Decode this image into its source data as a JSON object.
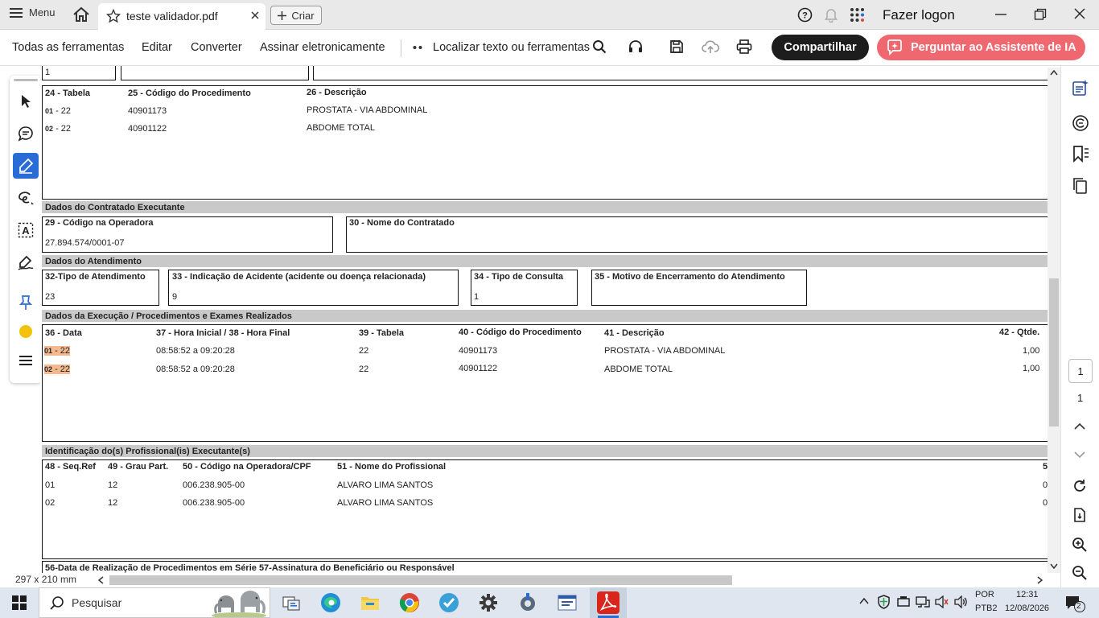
{
  "titlebar": {
    "menu_label": "Menu",
    "tab_title": "teste validador.pdf",
    "create_label": "Criar",
    "login_label": "Fazer logon"
  },
  "toolbar": {
    "all_tools": "Todas as ferramentas",
    "edit": "Editar",
    "convert": "Converter",
    "sign": "Assinar eletronicamente",
    "find": "Localizar texto ou ferramentas",
    "share": "Compartilhar",
    "ai": "Perguntar ao Assistente de IA"
  },
  "doc": {
    "top_row_value": "1",
    "proc_headers": {
      "tabela": "24 - Tabela",
      "codigo": "25 - Código do Procedimento",
      "descricao": "26 - Descrição"
    },
    "proc_rows": [
      {
        "idx": "01",
        "tabela": "22",
        "codigo": "40901173",
        "descricao": "PROSTATA - VIA  ABDOMINAL"
      },
      {
        "idx": "02",
        "tabela": "22",
        "codigo": "40901122",
        "descricao": "ABDOME TOTAL"
      }
    ],
    "sec_contratado": "Dados do Contratado Executante",
    "cod_operadora_label": "29 - Código na Operadora",
    "cod_operadora_value": "27.894.574/0001-07",
    "nome_contratado_label": "30 - Nome do Contratado",
    "sec_atendimento": "Dados do Atendimento",
    "tipo_atendimento_label": "32-Tipo de  Atendimento",
    "tipo_atendimento_value": "23",
    "acidente_label": "33 - Indicação de Acidente  (acidente ou doença relacionada)",
    "acidente_value": "9",
    "tipo_consulta_label": "34 - Tipo de Consulta",
    "tipo_consulta_value": "1",
    "motivo_label": "35 - Motivo de Encerramento do Atendimento",
    "sec_execucao": "Dados da Execução / Procedimentos e Exames Realizados",
    "exec_headers": {
      "data": "36 - Data",
      "hora": "37 - Hora Inicial / 38 - Hora Final",
      "tabela": "39 - Tabela",
      "codigo": "40 - Código do Procedimento",
      "descricao": "41 - Descrição",
      "qtde": "42 - Qtde."
    },
    "exec_rows": [
      {
        "idx": "01",
        "data": "22",
        "hora": "08:58:52 a 09:20:28",
        "tabela": "22",
        "codigo": "40901173",
        "descricao": "PROSTATA - VIA  ABDOMINAL",
        "qtde": "1,00"
      },
      {
        "idx": "02",
        "data": "22",
        "hora": "08:58:52 a 09:20:28",
        "tabela": "22",
        "codigo": "40901122",
        "descricao": "ABDOME TOTAL",
        "qtde": "1,00"
      }
    ],
    "sec_profissional": "Identificação do(s) Profissional(is) Executante(s)",
    "prof_headers": {
      "seq": "48 - Seq.Ref",
      "grau": "49 - Grau Part.",
      "cpf": "50 - Código na Operadora/CPF",
      "nome": "51 - Nome do Profissional",
      "cut": "5"
    },
    "prof_rows": [
      {
        "seq": "01",
        "grau": "12",
        "cpf": "006.238.905-00",
        "nome": "ALVARO LIMA SANTOS",
        "cut": "0"
      },
      {
        "seq": "02",
        "grau": "12",
        "cpf": "006.238.905-00",
        "nome": "ALVARO LIMA SANTOS",
        "cut": "0"
      }
    ],
    "bottom_labels": "56-Data de Realização de Procedimentos em Série  57-Assinatura do Beneficiário ou Responsável"
  },
  "status": {
    "page_size": "297 x 210 mm"
  },
  "pager": {
    "current": "1",
    "total": "1"
  },
  "taskbar": {
    "search_label": "Pesquisar",
    "lang_1": "POR",
    "lang_2": "PTB2",
    "time": "12:31",
    "date": "12/08/2026",
    "notifications": "2"
  },
  "colors": {
    "accent_blue": "#2a6cd6",
    "ai_button": "#f0686f",
    "highlight": "#f6b88e",
    "section_gray": "#c9c9c9"
  }
}
